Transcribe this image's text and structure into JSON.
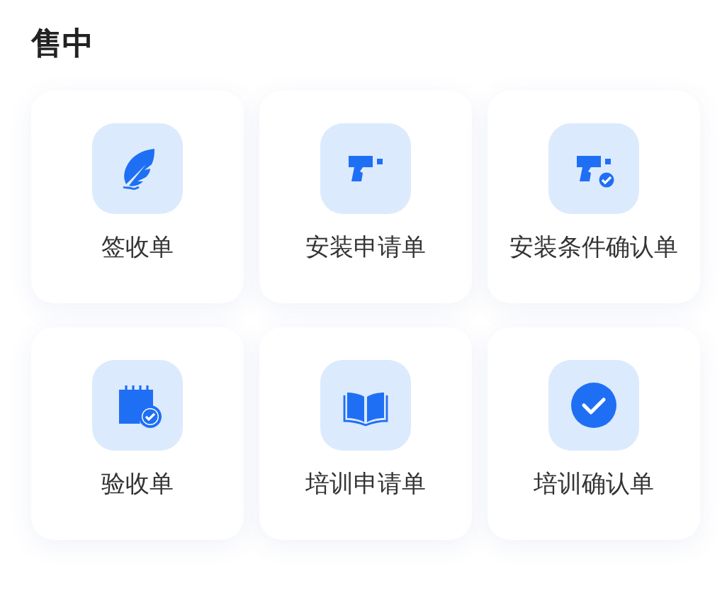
{
  "section": {
    "title": "售中"
  },
  "items": [
    {
      "label": "签收单",
      "kind": "feather"
    },
    {
      "label": "安装申请单",
      "kind": "drill"
    },
    {
      "label": "安装条件确认单",
      "kind": "drill-check"
    },
    {
      "label": "验收单",
      "kind": "calendar-check"
    },
    {
      "label": "培训申请单",
      "kind": "book"
    },
    {
      "label": "培训确认单",
      "kind": "check-circle"
    }
  ]
}
